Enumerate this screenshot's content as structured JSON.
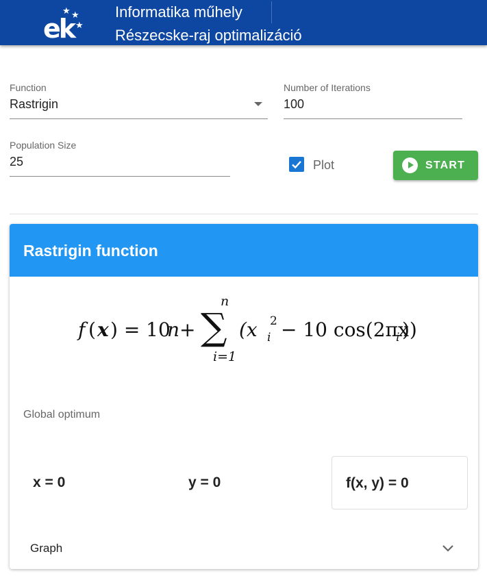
{
  "header": {
    "logo_text": "ek",
    "title": "Informatika műhely",
    "subtitle": "Részecske-raj optimalizáció"
  },
  "form": {
    "function_label": "Function",
    "function_value": "Rastrigin",
    "iterations_label": "Number of Iterations",
    "iterations_value": "100",
    "population_label": "Population Size",
    "population_value": "25",
    "plot_label": "Plot",
    "plot_checked": true,
    "start_label": "START"
  },
  "card": {
    "title": "Rastrigin function",
    "formula": {
      "f": "f",
      "lparen": "(",
      "x": "x",
      "rparen_eq": ") = 10",
      "n": "n",
      "plus": " +",
      "sigma": "∑",
      "sum_top": "n",
      "sum_bottom": "i=1",
      "open": "(x",
      "sq": "2",
      "sub_i": "i",
      "minus_cos": "− 10 cos(2πx",
      "sub_i2": "i",
      "close": "))"
    },
    "optimum_label": "Global optimum",
    "optimum": {
      "x": "x = 0",
      "y": "y = 0",
      "f": "f(x, y) = 0"
    },
    "graph_label": "Graph"
  },
  "colors": {
    "header_bg": "#0d47a1",
    "card_header_bg": "#2196f3",
    "start_bg": "#4caf50",
    "checkbox": "#1976d2"
  }
}
